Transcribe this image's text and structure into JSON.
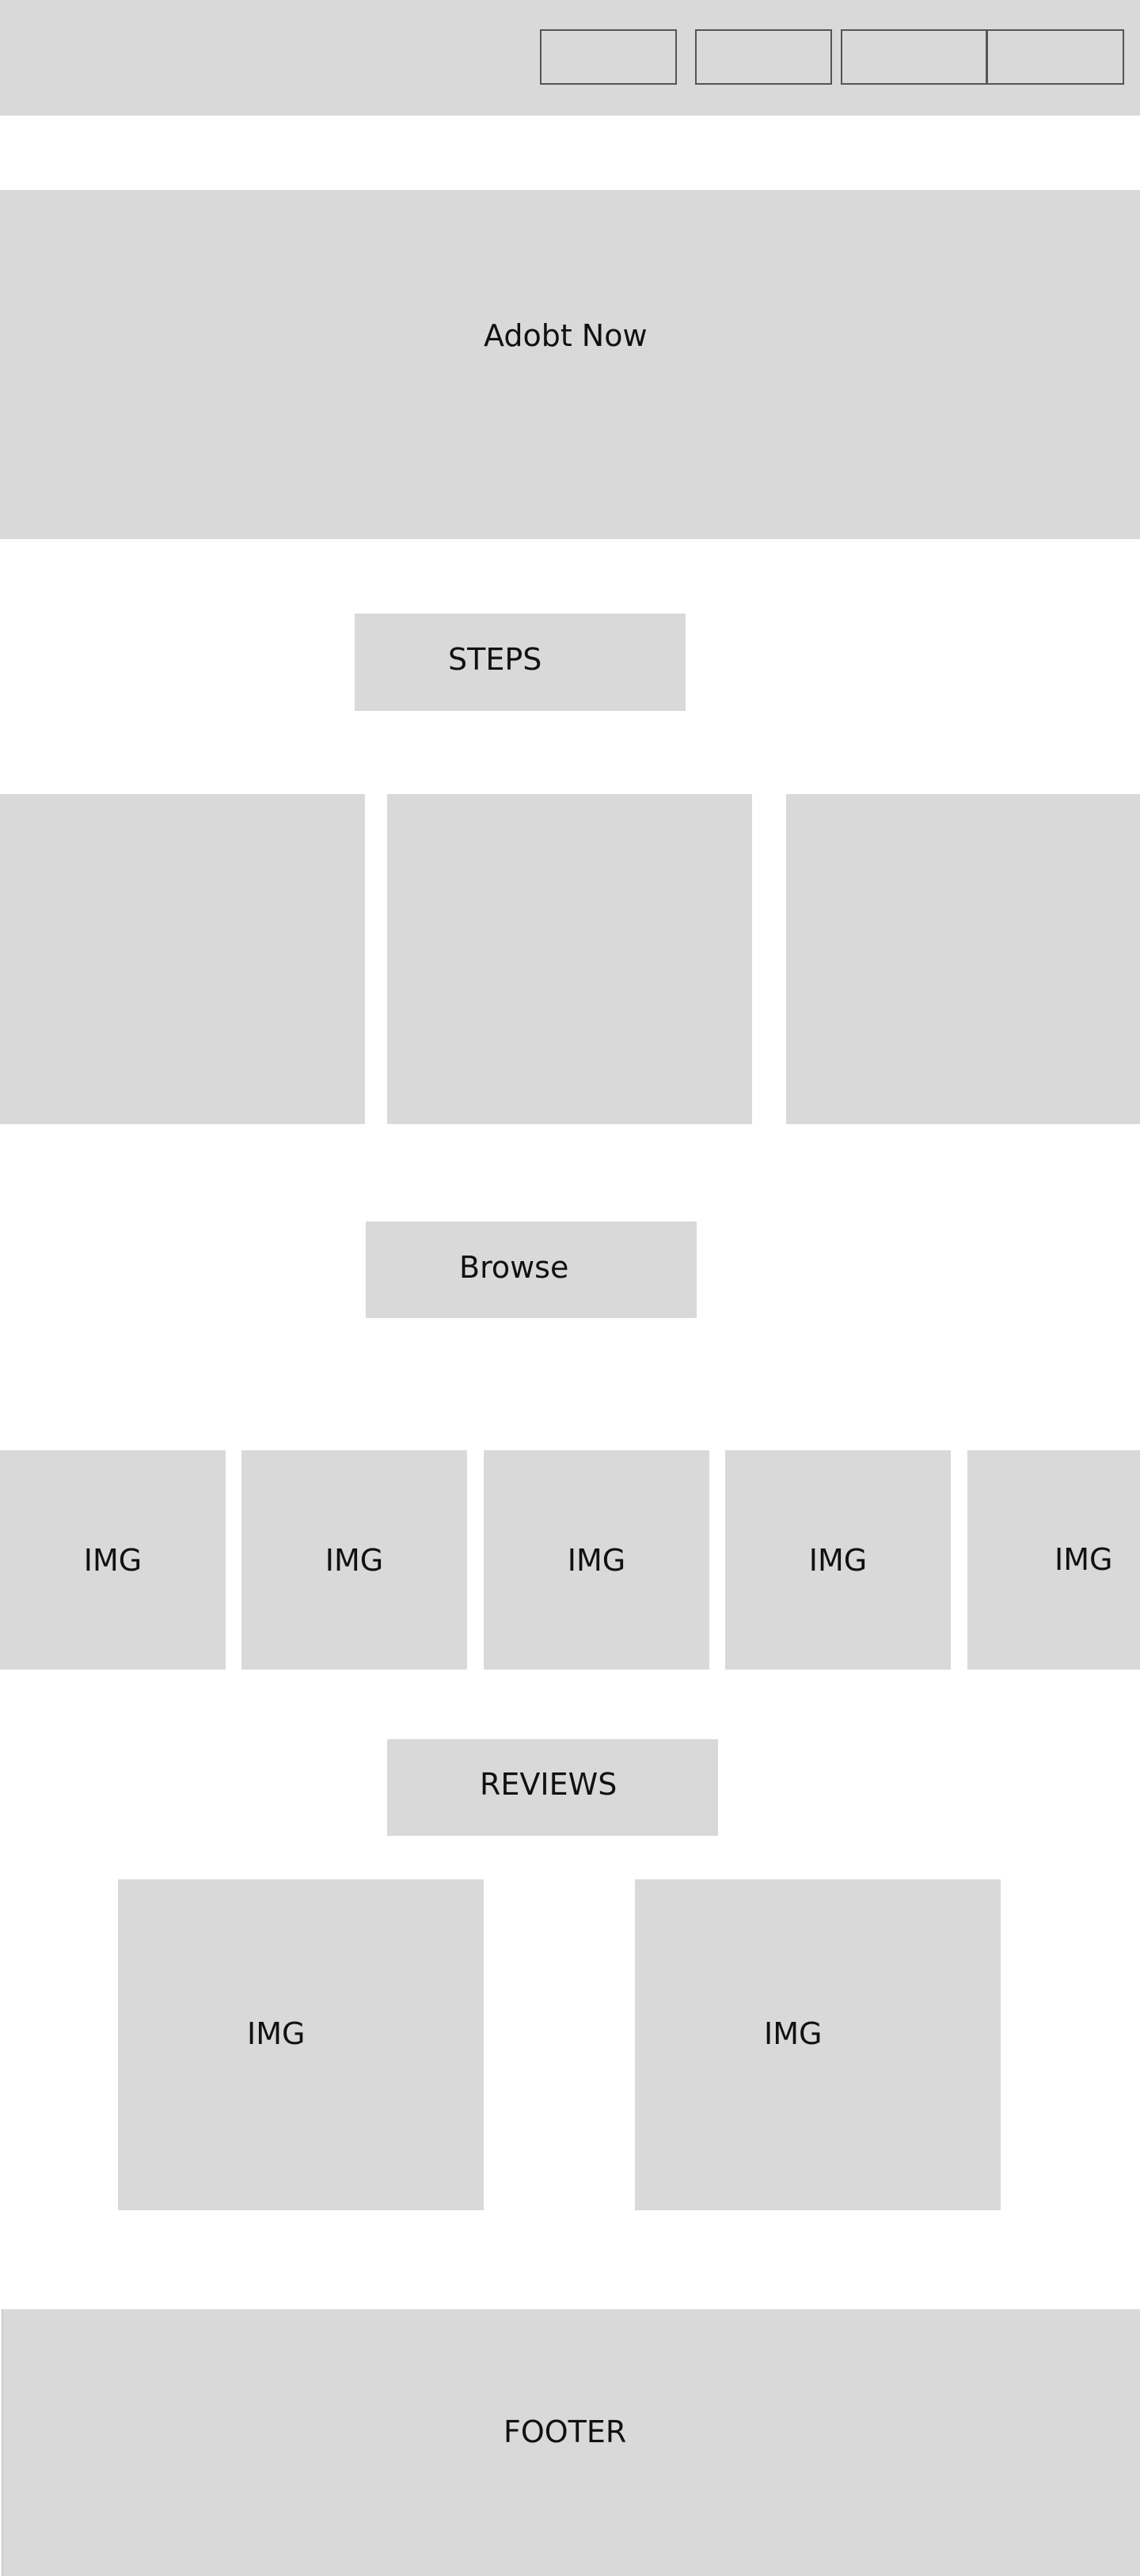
{
  "header": {
    "nav_buttons": [
      "",
      "",
      "",
      ""
    ]
  },
  "hero": {
    "title": "Adobt Now"
  },
  "steps": {
    "heading": "STEPS",
    "cards": [
      "",
      "",
      ""
    ]
  },
  "browse": {
    "heading": "Browse",
    "images": [
      "IMG",
      "IMG",
      "IMG",
      "IMG",
      "IMG"
    ]
  },
  "reviews": {
    "heading": "REVIEWS",
    "images": [
      "IMG",
      "IMG"
    ]
  },
  "footer": {
    "label": "FOOTER"
  },
  "colors": {
    "placeholder_fill": "#d9d9d9",
    "border": "#555555",
    "text": "#111111",
    "background": "#ffffff"
  }
}
